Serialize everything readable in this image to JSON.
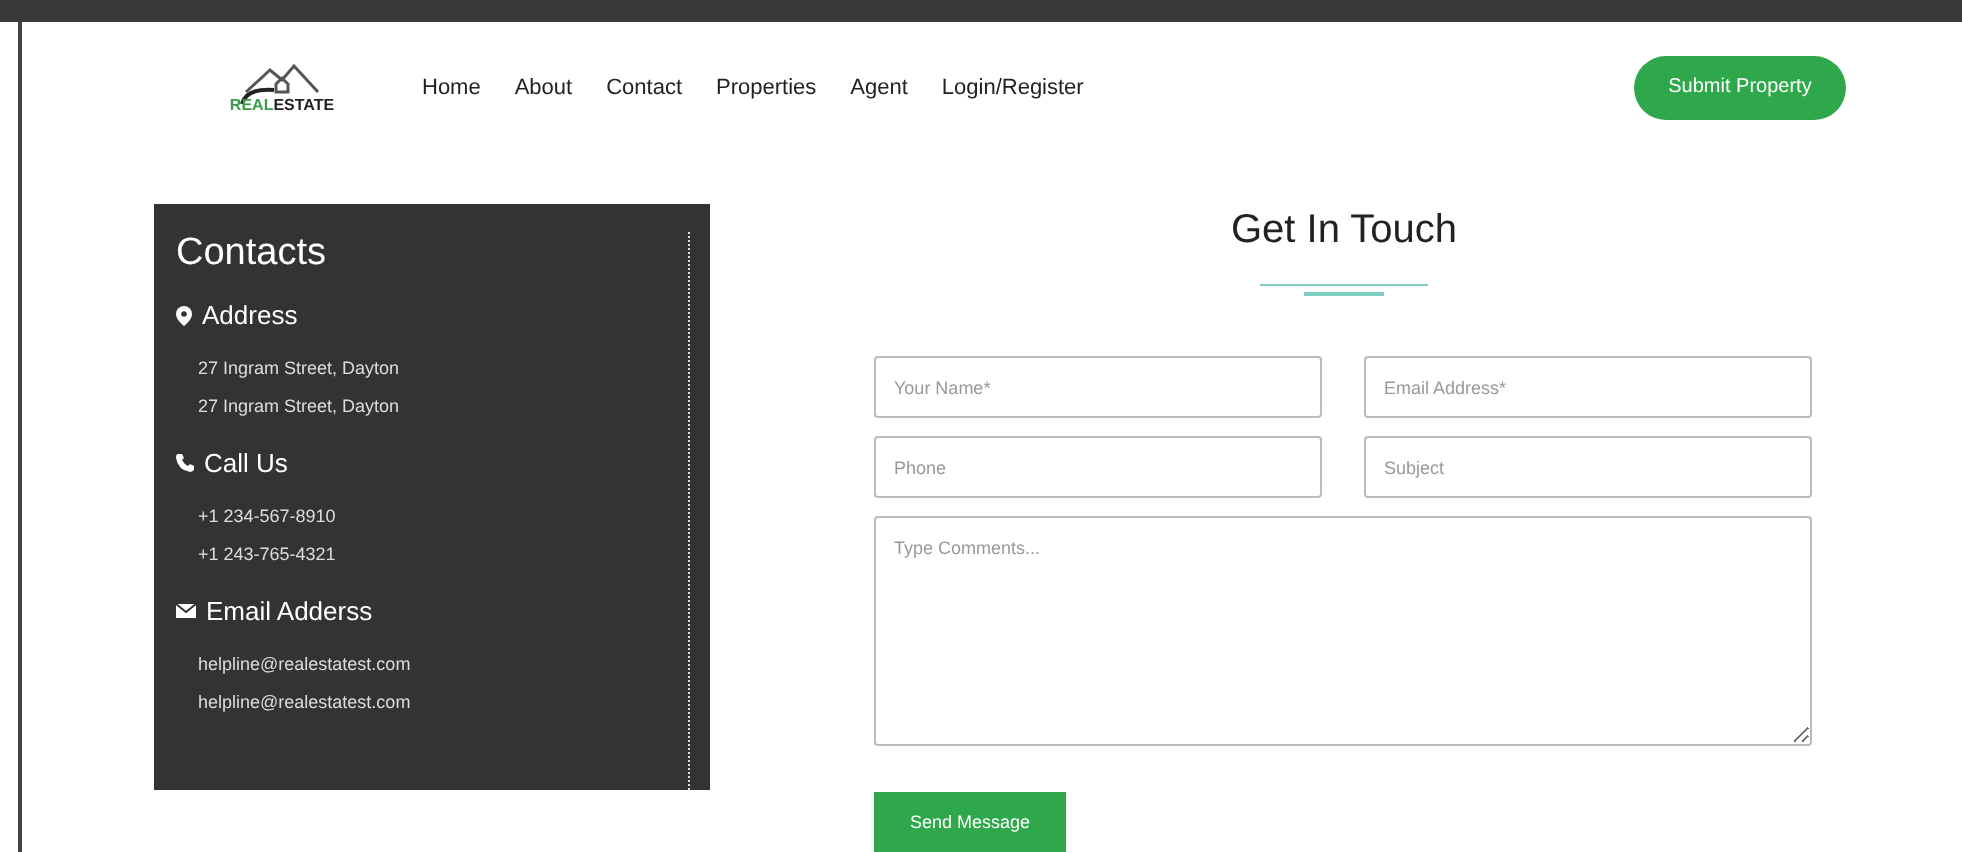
{
  "header": {
    "logo": [
      {
        "text": "REAL",
        "kind": "accent"
      },
      {
        "text": "ESTATE",
        "kind": "plain"
      }
    ],
    "nav": [
      "Home",
      "About",
      "Contact",
      "Properties",
      "Agent",
      "Login/Register"
    ],
    "cta": "Submit Property"
  },
  "contacts": {
    "title": "Contacts",
    "sections": [
      {
        "kind": "address",
        "heading": "Address",
        "lines": [
          "27 Ingram Street, Dayton",
          "27 Ingram Street, Dayton"
        ]
      },
      {
        "kind": "phone",
        "heading": "Call Us",
        "lines": [
          "+1 234-567-8910",
          "+1 243-765-4321"
        ]
      },
      {
        "kind": "email",
        "heading": "Email Adderss",
        "lines": [
          "helpline@realestatest.com",
          "helpline@realestatest.com"
        ]
      }
    ]
  },
  "form": {
    "title": "Get In Touch",
    "fields": [
      {
        "placeholder": "Your Name*",
        "kind": "input"
      },
      {
        "placeholder": "Email Address*",
        "kind": "input"
      },
      {
        "placeholder": "Phone",
        "kind": "input"
      },
      {
        "placeholder": "Subject",
        "kind": "input"
      },
      {
        "placeholder": "Type Comments...",
        "kind": "textarea"
      }
    ],
    "submit": "Send Message"
  }
}
